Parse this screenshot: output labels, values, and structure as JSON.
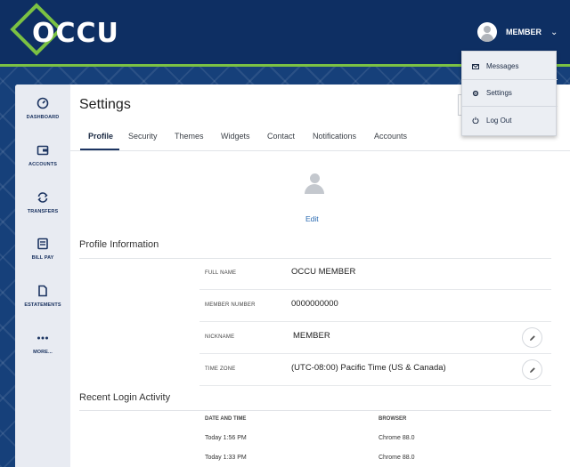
{
  "header": {
    "logo_text": "OCCU",
    "user_label": "MEMBER",
    "user_menu": [
      {
        "label": "Messages",
        "icon": "mail-icon"
      },
      {
        "label": "Settings",
        "icon": "gear-icon"
      },
      {
        "label": "Log Out",
        "icon": "power-icon"
      }
    ]
  },
  "sidenav": [
    {
      "label": "DASHBOARD",
      "icon": "gauge-icon"
    },
    {
      "label": "ACCOUNTS",
      "icon": "wallet-icon"
    },
    {
      "label": "TRANSFERS",
      "icon": "transfer-icon"
    },
    {
      "label": "BILL PAY",
      "icon": "bill-icon"
    },
    {
      "label": "ESTATEMENTS",
      "icon": "document-icon"
    },
    {
      "label": "MORE...",
      "icon": "more-icon"
    }
  ],
  "page": {
    "title": "Settings",
    "tabs": [
      "Profile",
      "Security",
      "Themes",
      "Widgets",
      "Contact",
      "Notifications",
      "Accounts"
    ],
    "active_tab": "Profile",
    "edit_link": "Edit"
  },
  "profile_info": {
    "heading": "Profile Information",
    "rows": [
      {
        "label": "FULL NAME",
        "value": "OCCU MEMBER",
        "editable": false
      },
      {
        "label": "MEMBER NUMBER",
        "value": "0000000000",
        "editable": false
      },
      {
        "label": "NICKNAME",
        "value": "MEMBER",
        "editable": true
      },
      {
        "label": "TIME ZONE",
        "value": "(UTC-08:00) Pacific Time (US & Canada)",
        "editable": true
      }
    ]
  },
  "login_activity": {
    "heading": "Recent Login Activity",
    "columns": [
      "DATE AND TIME",
      "BROWSER"
    ],
    "rows": [
      [
        "Today 1:56 PM",
        "Chrome 88.0"
      ],
      [
        "Today 1:33 PM",
        "Chrome 88.0"
      ]
    ]
  },
  "colors": {
    "header_bg": "#0e2f63",
    "accent_green": "#7bc143",
    "nav_bg": "#e8ebf2",
    "link_blue": "#2a6ab2"
  }
}
